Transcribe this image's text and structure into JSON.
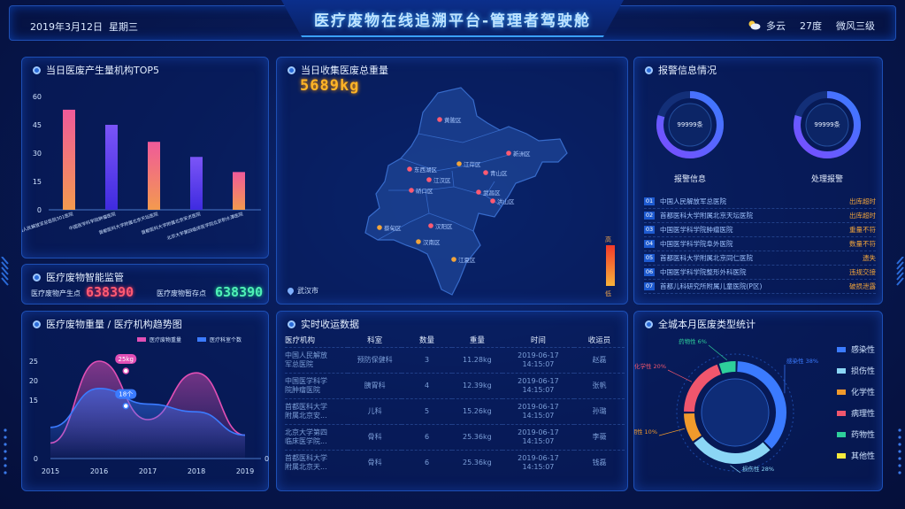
{
  "header": {
    "title": "医疗废物在线追溯平台-管理者驾驶舱",
    "date": "2019年3月12日",
    "weekday": "星期三",
    "weather": "多云",
    "temperature": "27度",
    "wind": "微风三级"
  },
  "panel_top5": {
    "title": "当日医废产生量机构TOP5"
  },
  "panel_map": {
    "title": "当日收集医废总重量",
    "total": "5689kg",
    "city": "武汉市",
    "legend_high": "高",
    "legend_low": "低",
    "districts": [
      "黄陂区",
      "新洲区",
      "东西湖区",
      "江岸区",
      "青山区",
      "江汉区",
      "硚口区",
      "武昌区",
      "洪山区",
      "汉阳区",
      "蔡甸区",
      "汉南区",
      "江夏区"
    ]
  },
  "panel_alarm": {
    "title": "报警信息情况",
    "ring1_value": "99999条",
    "ring1_label": "报警信息",
    "ring2_value": "99999条",
    "ring2_label": "处理报警",
    "rows": [
      {
        "idx": "01",
        "inst": "中国人民解放军总医院",
        "status": "出库超时"
      },
      {
        "idx": "02",
        "inst": "首都医科大学附属北京天坛医院",
        "status": "出库超时"
      },
      {
        "idx": "03",
        "inst": "中国医学科学院肿瘤医院",
        "status": "重量不符"
      },
      {
        "idx": "04",
        "inst": "中国医学科学院阜外医院",
        "status": "数量不符"
      },
      {
        "idx": "05",
        "inst": "首都医科大学附属北京同仁医院",
        "status": "遗失"
      },
      {
        "idx": "06",
        "inst": "中国医学科学院整形外科医院",
        "status": "违规交接"
      },
      {
        "idx": "07",
        "inst": "首都儿科研究所附属儿童医院(P区)",
        "status": "破损泄露"
      }
    ]
  },
  "panel_monitor": {
    "title": "医疗废物智能监管",
    "produce_label": "医疗废物产生点",
    "produce_value": "638390",
    "store_label": "医疗废物暂存点",
    "store_value": "638390"
  },
  "panel_trend": {
    "title": "医疗废物重量 / 医疗机构趋势图",
    "legend1": "医疗废物重量",
    "legend2": "医疗科室个数",
    "tip1": "25kg",
    "tip2": "18个"
  },
  "panel_realtime": {
    "title": "实时收运数据",
    "columns": [
      "医疗机构",
      "科室",
      "数量",
      "重量",
      "时间",
      "收运员"
    ],
    "rows": [
      {
        "inst": "中国人民解放\n军总医院",
        "dept": "预防保健科",
        "qty": "3",
        "weight": "11.28kg",
        "time": "2019-06-17\n14:15:07",
        "staff": "赵磊"
      },
      {
        "inst": "中国医学科学\n院肿瘤医院",
        "dept": "胰胃科",
        "qty": "4",
        "weight": "12.39kg",
        "time": "2019-06-17\n14:15:07",
        "staff": "张帆"
      },
      {
        "inst": "首都医科大学\n附属北京安...",
        "dept": "儿科",
        "qty": "5",
        "weight": "15.26kg",
        "time": "2019-06-17\n14:15:07",
        "staff": "孙璐"
      },
      {
        "inst": "北京大学第四\n临床医学院...",
        "dept": "骨科",
        "qty": "6",
        "weight": "25.36kg",
        "time": "2019-06-17\n14:15:07",
        "staff": "李薇"
      },
      {
        "inst": "首都医科大学\n附属北京天...",
        "dept": "骨科",
        "qty": "6",
        "weight": "25.36kg",
        "time": "2019-06-17\n14:15:07",
        "staff": "钱磊"
      }
    ]
  },
  "panel_types": {
    "title": "全城本月医废类型统计",
    "legend": [
      {
        "name": "感染性",
        "color": "#3b7bff"
      },
      {
        "name": "损伤性",
        "color": "#8bd6f5"
      },
      {
        "name": "化学性",
        "color": "#f19a2c"
      },
      {
        "name": "病理性",
        "color": "#f0566d"
      },
      {
        "name": "药物性",
        "color": "#2ecf9b"
      },
      {
        "name": "其他性",
        "color": "#f7ea3c"
      }
    ]
  },
  "chart_data": [
    {
      "type": "bar",
      "title": "当日医废产生量机构TOP5",
      "categories": [
        "中国人民解放军总医院301医院",
        "中国医学科学院肿瘤医院",
        "首都医科大学附属北京天坛医院",
        "首都医科大学附属北京安贞医院",
        "北京大学第四临床医学院北京积水潭医院"
      ],
      "values": [
        53,
        45,
        36,
        28,
        20
      ],
      "ylim": [
        0,
        60
      ],
      "yticks": [
        0,
        15,
        30,
        45,
        60
      ],
      "colors_top": [
        "#f05a9a",
        "#7b55f7",
        "#f05a9a",
        "#7b55f7",
        "#f05a9a"
      ],
      "colors_bottom": [
        "#f39a4f",
        "#3f2be0",
        "#f39a4f",
        "#3f2be0",
        "#f39a4f"
      ]
    },
    {
      "type": "area",
      "title": "医疗废物重量 / 医疗机构趋势图",
      "x": [
        "2015",
        "2016",
        "2017",
        "2018",
        "2019"
      ],
      "ylim": [
        0,
        25
      ],
      "yticks": [
        0,
        15,
        20,
        25
      ],
      "right_tick": "0",
      "series": [
        {
          "name": "医疗废物重量",
          "color": "#e14fb5",
          "values": [
            4,
            25,
            10,
            22,
            6
          ]
        },
        {
          "name": "医疗科室个数",
          "color": "#3b7bff",
          "values": [
            8,
            18,
            14,
            12,
            6
          ]
        }
      ]
    },
    {
      "type": "pie",
      "title": "全城本月医废类型统计",
      "slices": [
        {
          "name": "感染性",
          "value": 38,
          "label": "感染性 38%",
          "color": "#3b7bff"
        },
        {
          "name": "损伤性",
          "value": 28,
          "label": "损伤性 28%",
          "color": "#8bd6f5"
        },
        {
          "name": "周期性",
          "value": 10,
          "label": "周期性 10%",
          "color": "#f19a2c"
        },
        {
          "name": "化学性",
          "value": 20,
          "label": "化学性 20%",
          "color": "#f0566d"
        },
        {
          "name": "药物性",
          "value": 6,
          "label": "药物性 6%",
          "color": "#2ecf9b"
        }
      ]
    }
  ]
}
